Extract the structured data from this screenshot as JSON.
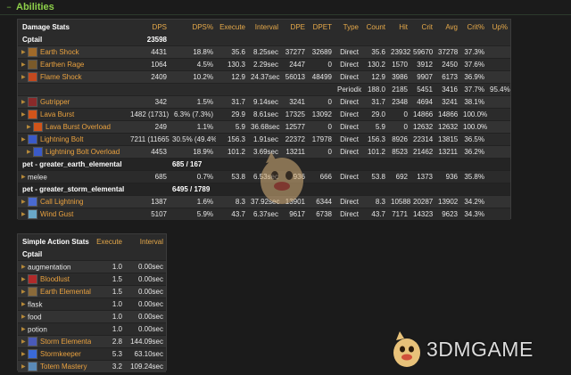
{
  "header": {
    "toggle_symbol": "−",
    "title": "Abilities"
  },
  "colors": {
    "accent_green": "#8ed04a",
    "header_orange": "#e6a94a",
    "spell_orange": "#e9a13f"
  },
  "damage_stats": {
    "columns": [
      "Damage Stats",
      "DPS",
      "DPS%",
      "Execute",
      "Interval",
      "DPE",
      "DPET",
      "Type",
      "Count",
      "Hit",
      "Crit",
      "Avg",
      "Crit%",
      "Up%"
    ],
    "player": {
      "name": "Cptail",
      "dps": "23598"
    },
    "rows": [
      {
        "kind": "spell",
        "icon": "earth-shock-icon",
        "icon_color": "#a06a2a",
        "name": "Earth Shock",
        "dps": "4431",
        "dps_pct": "18.8%",
        "execute": "35.6",
        "interval": "8.25sec",
        "dpe": "37277",
        "dpet": "32689",
        "type": "Direct",
        "count": "35.6",
        "hit": "23932",
        "crit": "59670",
        "avg": "37278",
        "crit_pct": "37.3%",
        "up": ""
      },
      {
        "kind": "spell",
        "icon": "earthen-rage-icon",
        "icon_color": "#7a5a2a",
        "name": "Earthen Rage",
        "dps": "1064",
        "dps_pct": "4.5%",
        "execute": "130.3",
        "interval": "2.29sec",
        "dpe": "2447",
        "dpet": "0",
        "type": "Direct",
        "count": "130.2",
        "hit": "1570",
        "crit": "3912",
        "avg": "2450",
        "crit_pct": "37.6%",
        "up": ""
      },
      {
        "kind": "spell",
        "icon": "flame-shock-icon",
        "icon_color": "#c2491f",
        "name": "Flame Shock",
        "dps": "2409",
        "dps_pct": "10.2%",
        "execute": "12.9",
        "interval": "24.37sec",
        "dpe": "56013",
        "dpet": "48499",
        "type": "Direct",
        "count": "12.9",
        "hit": "3986",
        "crit": "9907",
        "avg": "6173",
        "crit_pct": "36.9%",
        "up": ""
      },
      {
        "kind": "periodic",
        "name": "",
        "dps": "",
        "dps_pct": "",
        "execute": "",
        "interval": "",
        "dpe": "",
        "dpet": "",
        "type": "Periodic",
        "count": "188.0",
        "hit": "2185",
        "crit": "5451",
        "avg": "3416",
        "crit_pct": "37.7%",
        "up": "95.4%"
      },
      {
        "kind": "spell",
        "icon": "gutripper-icon",
        "icon_color": "#8a2a2a",
        "name": "Gutripper",
        "dps": "342",
        "dps_pct": "1.5%",
        "execute": "31.7",
        "interval": "9.14sec",
        "dpe": "3241",
        "dpet": "0",
        "type": "Direct",
        "count": "31.7",
        "hit": "2348",
        "crit": "4694",
        "avg": "3241",
        "crit_pct": "38.1%",
        "up": ""
      },
      {
        "kind": "spell",
        "icon": "lava-burst-icon",
        "icon_color": "#d0541a",
        "name": "Lava Burst",
        "dps": "1482 (1731)",
        "dps_pct": "6.3% (7.3%)",
        "execute": "29.9",
        "interval": "8.61sec",
        "dpe": "17325",
        "dpet": "13092",
        "type": "Direct",
        "count": "29.0",
        "hit": "0",
        "crit": "14866",
        "avg": "14866",
        "crit_pct": "100.0%",
        "up": ""
      },
      {
        "kind": "child",
        "icon": "lava-burst-icon",
        "icon_color": "#d0541a",
        "name": "Lava Burst Overload",
        "dps": "249",
        "dps_pct": "1.1%",
        "execute": "5.9",
        "interval": "36.68sec",
        "dpe": "12577",
        "dpet": "0",
        "type": "Direct",
        "count": "5.9",
        "hit": "0",
        "crit": "12632",
        "avg": "12632",
        "crit_pct": "100.0%",
        "up": ""
      },
      {
        "kind": "spell",
        "icon": "lightning-bolt-icon",
        "icon_color": "#3a5ac8",
        "name": "Lightning Bolt",
        "dps": "7211 (11665)",
        "dps_pct": "30.5% (49.4%)",
        "execute": "156.3",
        "interval": "1.91sec",
        "dpe": "22372",
        "dpet": "17978",
        "type": "Direct",
        "count": "156.3",
        "hit": "8926",
        "crit": "22314",
        "avg": "13815",
        "crit_pct": "36.5%",
        "up": ""
      },
      {
        "kind": "child",
        "icon": "lightning-bolt-icon",
        "icon_color": "#3a5ac8",
        "name": "Lightning Bolt Overload",
        "dps": "4453",
        "dps_pct": "18.9%",
        "execute": "101.2",
        "interval": "3.69sec",
        "dpe": "13211",
        "dpet": "0",
        "type": "Direct",
        "count": "101.2",
        "hit": "8523",
        "crit": "21462",
        "avg": "13211",
        "crit_pct": "36.2%",
        "up": ""
      },
      {
        "kind": "group",
        "name": "pet - greater_earth_elemental",
        "dps": "685 / 167"
      },
      {
        "kind": "plain",
        "name": "melee",
        "dps": "685",
        "dps_pct": "0.7%",
        "execute": "53.8",
        "interval": "6.53sec",
        "dpe": "936",
        "dpet": "666",
        "type": "Direct",
        "count": "53.8",
        "hit": "692",
        "crit": "1373",
        "avg": "936",
        "crit_pct": "35.8%",
        "up": ""
      },
      {
        "kind": "group",
        "name": "pet - greater_storm_elemental",
        "dps": "6495 / 1789"
      },
      {
        "kind": "spell",
        "icon": "call-lightning-icon",
        "icon_color": "#4a6ad0",
        "name": "Call Lightning",
        "dps": "1387",
        "dps_pct": "1.6%",
        "execute": "8.3",
        "interval": "37.92sec",
        "dpe": "13901",
        "dpet": "6344",
        "type": "Direct",
        "count": "8.3",
        "hit": "10588",
        "crit": "20287",
        "avg": "13902",
        "crit_pct": "34.2%",
        "up": ""
      },
      {
        "kind": "spell",
        "icon": "wind-gust-icon",
        "icon_color": "#6aa8c8",
        "name": "Wind Gust",
        "dps": "5107",
        "dps_pct": "5.9%",
        "execute": "43.7",
        "interval": "6.37sec",
        "dpe": "9617",
        "dpet": "6738",
        "type": "Direct",
        "count": "43.7",
        "hit": "7171",
        "crit": "14323",
        "avg": "9623",
        "crit_pct": "34.3%",
        "up": ""
      }
    ]
  },
  "action_stats": {
    "columns": [
      "Simple Action Stats",
      "Execute",
      "Interval"
    ],
    "player": "Cptail",
    "rows": [
      {
        "icon": "",
        "icon_color": "",
        "name": "augmentation",
        "execute": "1.0",
        "interval": "0.00sec",
        "plain": true
      },
      {
        "icon": "bloodlust-icon",
        "icon_color": "#b02a2a",
        "name": "Bloodlust",
        "execute": "1.5",
        "interval": "0.00sec",
        "plain": false
      },
      {
        "icon": "earth-elemental-icon",
        "icon_color": "#8a6a3a",
        "name": "Earth Elemental",
        "execute": "1.5",
        "interval": "0.00sec",
        "plain": false
      },
      {
        "icon": "",
        "icon_color": "",
        "name": "flask",
        "execute": "1.0",
        "interval": "0.00sec",
        "plain": true
      },
      {
        "icon": "",
        "icon_color": "",
        "name": "food",
        "execute": "1.0",
        "interval": "0.00sec",
        "plain": true
      },
      {
        "icon": "",
        "icon_color": "",
        "name": "potion",
        "execute": "1.0",
        "interval": "0.00sec",
        "plain": true
      },
      {
        "icon": "storm-elemental-icon",
        "icon_color": "#4a5ab8",
        "name": "Storm Elemental",
        "execute": "2.8",
        "interval": "144.09sec",
        "plain": false
      },
      {
        "icon": "stormkeeper-icon",
        "icon_color": "#3a6ad8",
        "name": "Stormkeeper",
        "execute": "5.3",
        "interval": "63.10sec",
        "plain": false
      },
      {
        "icon": "totem-mastery-icon",
        "icon_color": "#5a8ab8",
        "name": "Totem Mastery",
        "execute": "3.2",
        "interval": "109.24sec",
        "plain": false
      }
    ]
  },
  "watermark": {
    "text": "3DMGAME"
  }
}
